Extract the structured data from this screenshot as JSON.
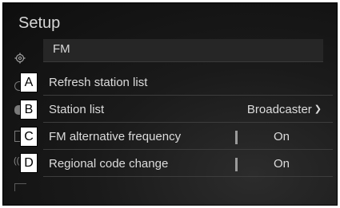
{
  "header": {
    "title": "Setup"
  },
  "band": {
    "label": "FM"
  },
  "sidebar_icons": [
    "gear-icon",
    "audio-source-icon",
    "speaker-icon",
    "radio-icon",
    "phone-icon",
    "connection-icon"
  ],
  "rows": [
    {
      "letter": "A",
      "label": "Refresh station list"
    },
    {
      "letter": "B",
      "label": "Station list",
      "value": "Broadcaster",
      "control": "dropdown"
    },
    {
      "letter": "C",
      "label": "FM alternative frequency",
      "value": "On",
      "control": "toggle"
    },
    {
      "letter": "D",
      "label": "Regional code change",
      "value": "On",
      "control": "toggle"
    }
  ]
}
